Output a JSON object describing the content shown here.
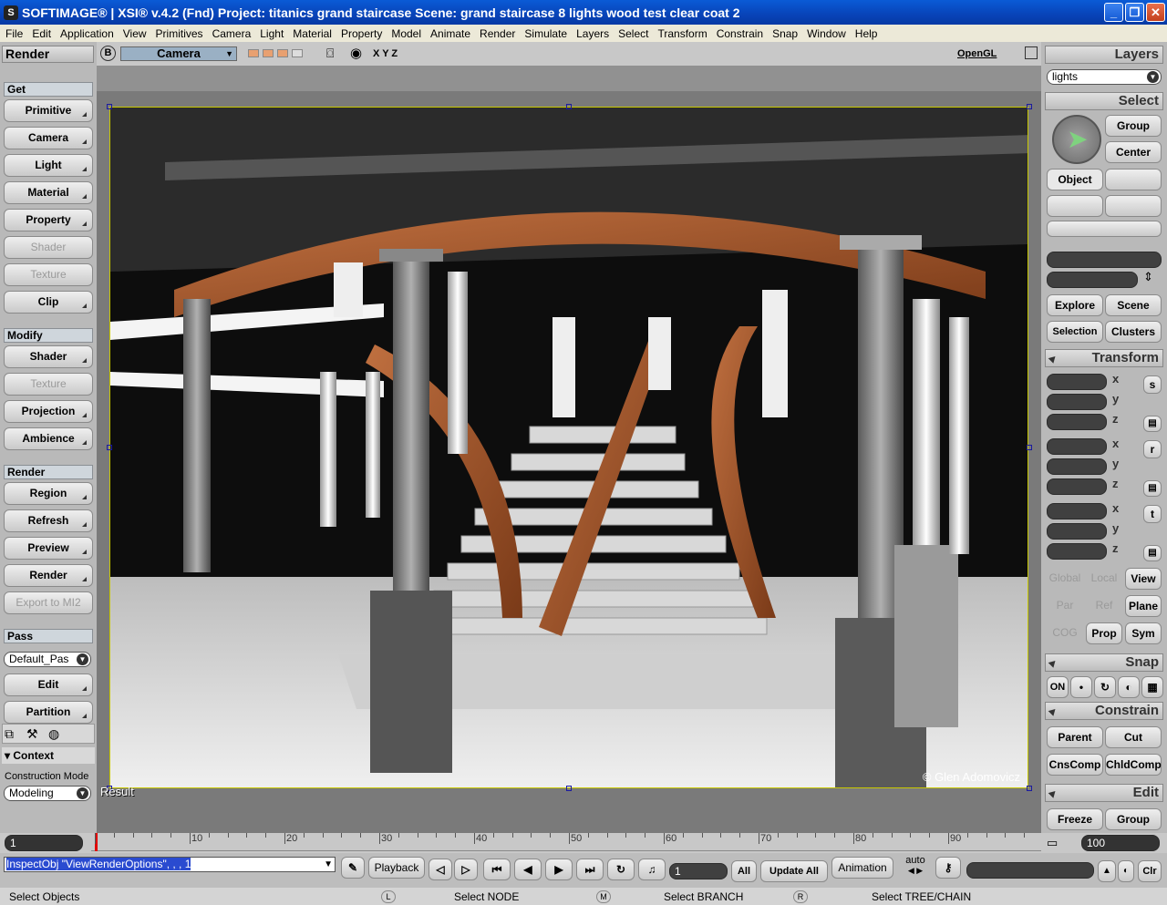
{
  "window": {
    "title": "SOFTIMAGE® | XSI® v.4.2 (Fnd) Project: titanics grand staircase    Scene:  grand staircase 8 lights wood test clear coat 2",
    "minimize_icon": "minimize-icon",
    "maximize_icon": "maximize-icon",
    "close_icon": "close-icon"
  },
  "menu": [
    "File",
    "Edit",
    "Application",
    "View",
    "Primitives",
    "Camera",
    "Light",
    "Material",
    "Property",
    "Model",
    "Animate",
    "Render",
    "Simulate",
    "Layers",
    "Select",
    "Transform",
    "Constrain",
    "Snap",
    "Window",
    "Help"
  ],
  "left_panel": {
    "title": "Render",
    "get_label": "Get",
    "get_buttons": [
      {
        "label": "Primitive",
        "enabled": true
      },
      {
        "label": "Camera",
        "enabled": true
      },
      {
        "label": "Light",
        "enabled": true
      },
      {
        "label": "Material",
        "enabled": true
      },
      {
        "label": "Property",
        "enabled": true
      },
      {
        "label": "Shader",
        "enabled": false
      },
      {
        "label": "Texture",
        "enabled": false
      },
      {
        "label": "Clip",
        "enabled": true
      }
    ],
    "modify_label": "Modify",
    "modify_buttons": [
      {
        "label": "Shader",
        "enabled": true
      },
      {
        "label": "Texture",
        "enabled": false
      },
      {
        "label": "Projection",
        "enabled": true
      },
      {
        "label": "Ambience",
        "enabled": true
      }
    ],
    "render_label": "Render",
    "render_buttons": [
      {
        "label": "Region",
        "enabled": true
      },
      {
        "label": "Refresh",
        "enabled": true
      },
      {
        "label": "Preview",
        "enabled": true
      },
      {
        "label": "Render",
        "enabled": true
      },
      {
        "label": "Export to MI2",
        "enabled": false
      }
    ],
    "pass_label": "Pass",
    "pass_value": "Default_Pas",
    "pass_buttons": [
      {
        "label": "Edit",
        "enabled": true
      },
      {
        "label": "Partition",
        "enabled": true
      }
    ],
    "context_label": "Context",
    "construction_mode_label": "Construction Mode",
    "construction_mode_value": "Modeling"
  },
  "viewport": {
    "b_label": "B",
    "camera_label": "Camera",
    "axes_label": "X  Y  Z",
    "display_mode": "OpenGL",
    "result_label": "Result",
    "watermark": "© Glen Adomovicz"
  },
  "right_panel": {
    "layers_title": "Layers",
    "layers_value": "lights",
    "select_title": "Select",
    "select_buttons": {
      "group": "Group",
      "center": "Center",
      "object": "Object"
    },
    "explore_buttons": [
      "Explore",
      "Scene",
      "Selection",
      "Clusters"
    ],
    "transform_title": "Transform",
    "axes": [
      "x",
      "y",
      "z"
    ],
    "transform_icons": [
      "s",
      "r",
      "t"
    ],
    "ref_buttons": [
      {
        "label": "Global",
        "enabled": false
      },
      {
        "label": "Local",
        "enabled": false
      },
      {
        "label": "View",
        "enabled": true
      },
      {
        "label": "Par",
        "enabled": false
      },
      {
        "label": "Ref",
        "enabled": false
      },
      {
        "label": "Plane",
        "enabled": true
      },
      {
        "label": "COG",
        "enabled": false
      },
      {
        "label": "Prop",
        "enabled": true
      },
      {
        "label": "Sym",
        "enabled": true
      }
    ],
    "snap_title": "Snap",
    "snap_on": "ON",
    "constrain_title": "Constrain",
    "constrain_buttons": [
      "Parent",
      "Cut",
      "CnsComp",
      "ChldComp"
    ],
    "edit_title": "Edit",
    "edit_buttons": [
      "Freeze",
      "Group"
    ]
  },
  "timeline": {
    "start_value": "1",
    "end_value": "100",
    "tick_labels": [
      "10",
      "20",
      "30",
      "40",
      "50",
      "60",
      "70",
      "80",
      "90"
    ]
  },
  "command_bar": {
    "command": "InspectObj \"ViewRenderOptions\", , , 1",
    "playback_label": "Playback",
    "frame_value": "1",
    "all_label": "All",
    "update_all_label": "Update All",
    "animation_label": "Animation",
    "auto_label": "auto"
  },
  "status": {
    "left": "Select Objects",
    "l_key": "L",
    "node": "Select NODE",
    "m_key": "M",
    "branch": "Select BRANCH",
    "r_key": "R",
    "tree": "Select TREE/CHAIN"
  },
  "colors": {
    "title_bar": "#0843b8",
    "panel": "#b9b9b9",
    "viewport_bg": "#7a7a7a",
    "wood": "#a0522d",
    "selection_frame": "#c8c800"
  }
}
